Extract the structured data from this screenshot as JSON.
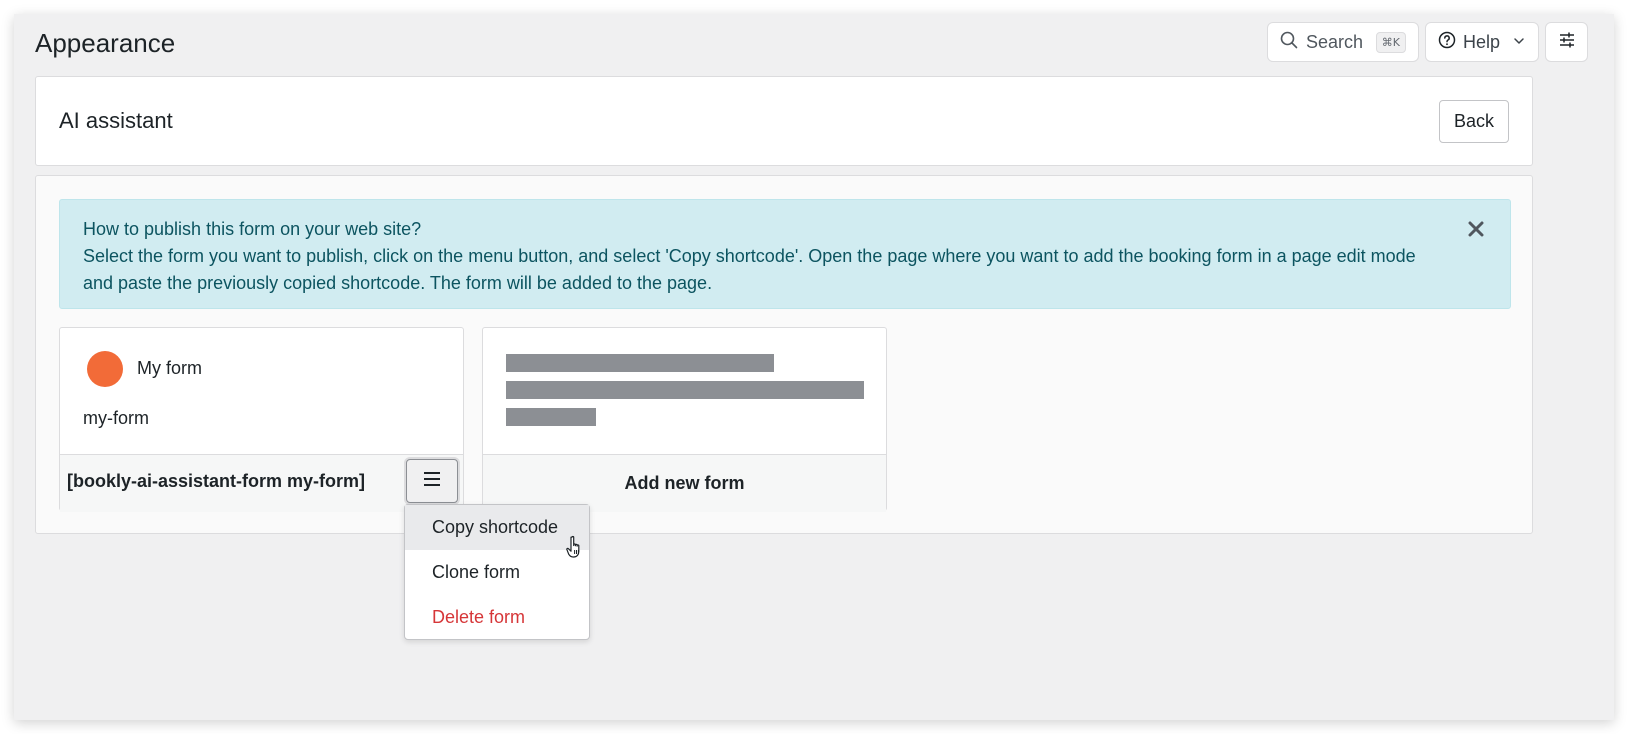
{
  "page": {
    "title": "Appearance"
  },
  "topbar": {
    "search_label": "Search",
    "search_shortcut": "⌘K",
    "help_label": "Help"
  },
  "header_card": {
    "title": "AI assistant",
    "back_label": "Back"
  },
  "notice": {
    "line1": "How to publish this form on your web site?",
    "line2": "Select the form you want to publish, click on the menu button, and select 'Copy shortcode'. Open the page where you want to add the booking form in a page edit mode and paste the previously copied shortcode. The form will be added to the page."
  },
  "forms": [
    {
      "name": "My form",
      "slug": "my-form",
      "shortcode": "[bookly-ai-assistant-form my-form]",
      "color": "#f26b38"
    }
  ],
  "add_form": {
    "label": "Add new form"
  },
  "form_menu": {
    "items": [
      {
        "label": "Copy shortcode",
        "state": "hover"
      },
      {
        "label": "Clone form",
        "state": "normal"
      },
      {
        "label": "Delete form",
        "state": "danger"
      }
    ]
  },
  "colors": {
    "background": "#f0f0f1",
    "notice_bg": "#d1ecf1",
    "notice_text": "#0c5460",
    "danger": "#d63638",
    "avatar": "#f26b38"
  },
  "icons": {
    "search": "search-icon",
    "help": "help-circle-icon",
    "chevron": "chevron-down-icon",
    "settings": "sliders-icon",
    "close": "close-icon",
    "menu": "hamburger-menu-icon",
    "cursor": "hand-pointer-icon"
  }
}
